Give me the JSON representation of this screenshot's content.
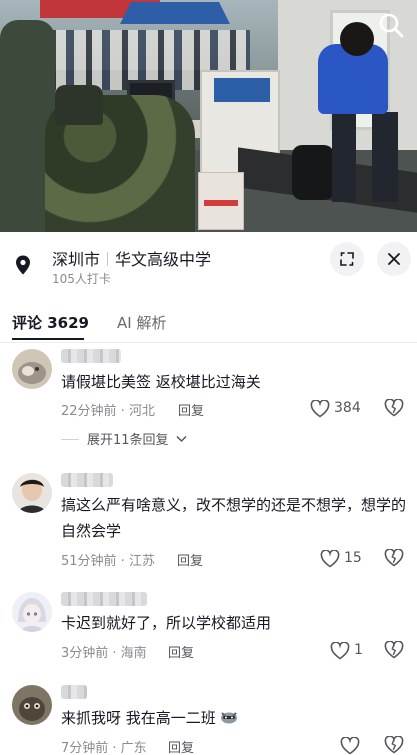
{
  "video": {
    "icons": [
      "search-icon"
    ],
    "sign_text": ""
  },
  "location": {
    "city": "深圳市",
    "place": "华文高级中学",
    "checkins": "105人打卡",
    "icons": [
      "location-pin-icon",
      "expand-icon",
      "close-icon"
    ]
  },
  "tabs": {
    "comments_label": "评论 3629",
    "ai_label": "AI 解析"
  },
  "comments": [
    {
      "text": "请假堪比美签 返校堪比过海关",
      "time_place": "22分钟前 · 河北",
      "reply_label": "回复",
      "likes": "384",
      "expand_label": "展开11条回复"
    },
    {
      "text": "搞这么严有啥意义，改不想学的还是不想学，想学的自然会学",
      "time_place": "51分钟前 · 江苏",
      "reply_label": "回复",
      "likes": "15"
    },
    {
      "text": "卡迟到就好了，所以学校都适用",
      "time_place": "3分钟前 · 海南",
      "reply_label": "回复",
      "likes": "1"
    },
    {
      "text": "来抓我呀 我在高一二班",
      "time_place": "7分钟前 · 广东",
      "reply_label": "回复",
      "likes": ""
    }
  ],
  "colors": {
    "primary_text": "#161823",
    "secondary_text": "#8a8b91",
    "button_bg": "#f2f2f4"
  }
}
